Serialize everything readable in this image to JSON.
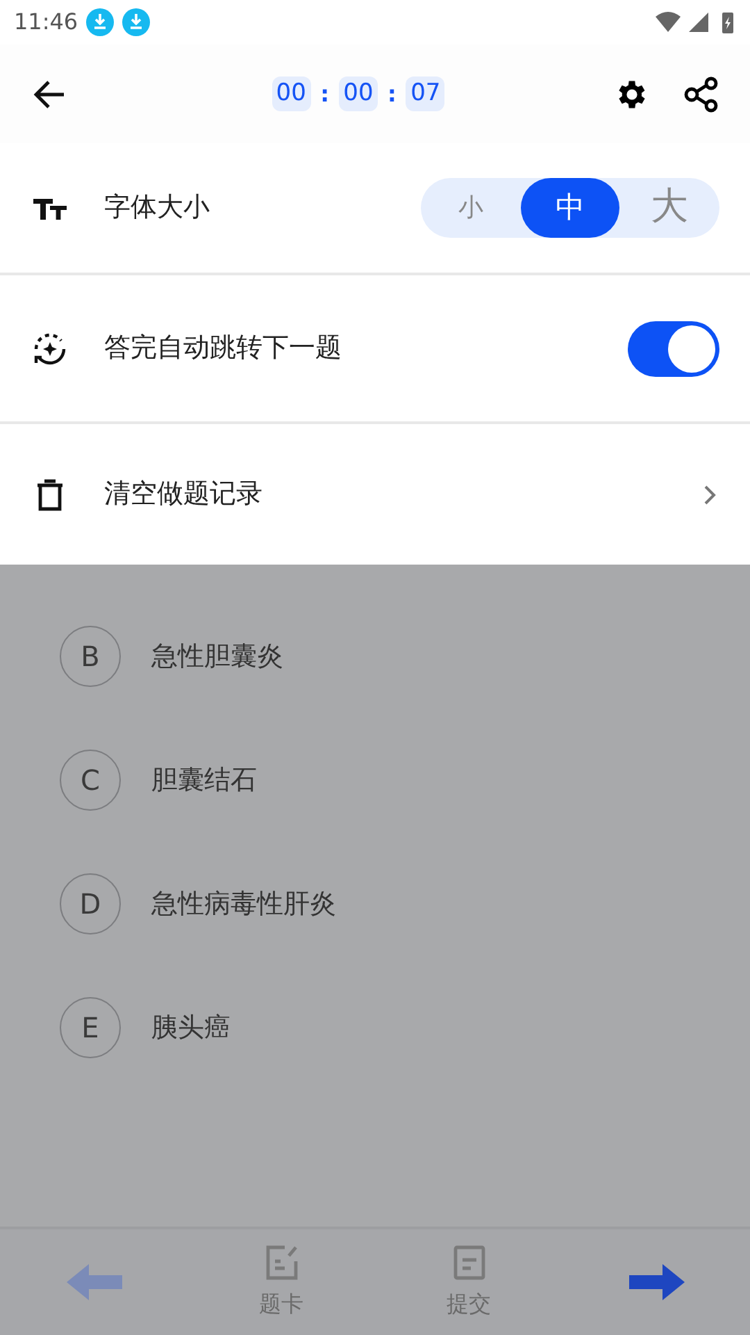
{
  "status_bar": {
    "time": "11:46"
  },
  "timer": {
    "parts": [
      "00",
      "00",
      "07"
    ],
    "separators": [
      ":",
      ":"
    ]
  },
  "settings": {
    "font_size": {
      "label": "字体大小",
      "options": [
        {
          "label": "小",
          "selected": false
        },
        {
          "label": "中",
          "selected": true
        },
        {
          "label": "大",
          "selected": false
        }
      ]
    },
    "auto_next": {
      "label": "答完自动跳转下一题",
      "on": true
    },
    "clear_record": {
      "label": "清空做题记录"
    }
  },
  "options": [
    {
      "letter": "B",
      "text": "急性胆囊炎"
    },
    {
      "letter": "C",
      "text": "胆囊结石"
    },
    {
      "letter": "D",
      "text": "急性病毒性肝炎"
    },
    {
      "letter": "E",
      "text": "胰头癌"
    }
  ],
  "bottom_nav": [
    {
      "kind": "prev"
    },
    {
      "kind": "tab",
      "label": "题卡"
    },
    {
      "kind": "tab",
      "label": "提交"
    },
    {
      "kind": "next"
    }
  ]
}
